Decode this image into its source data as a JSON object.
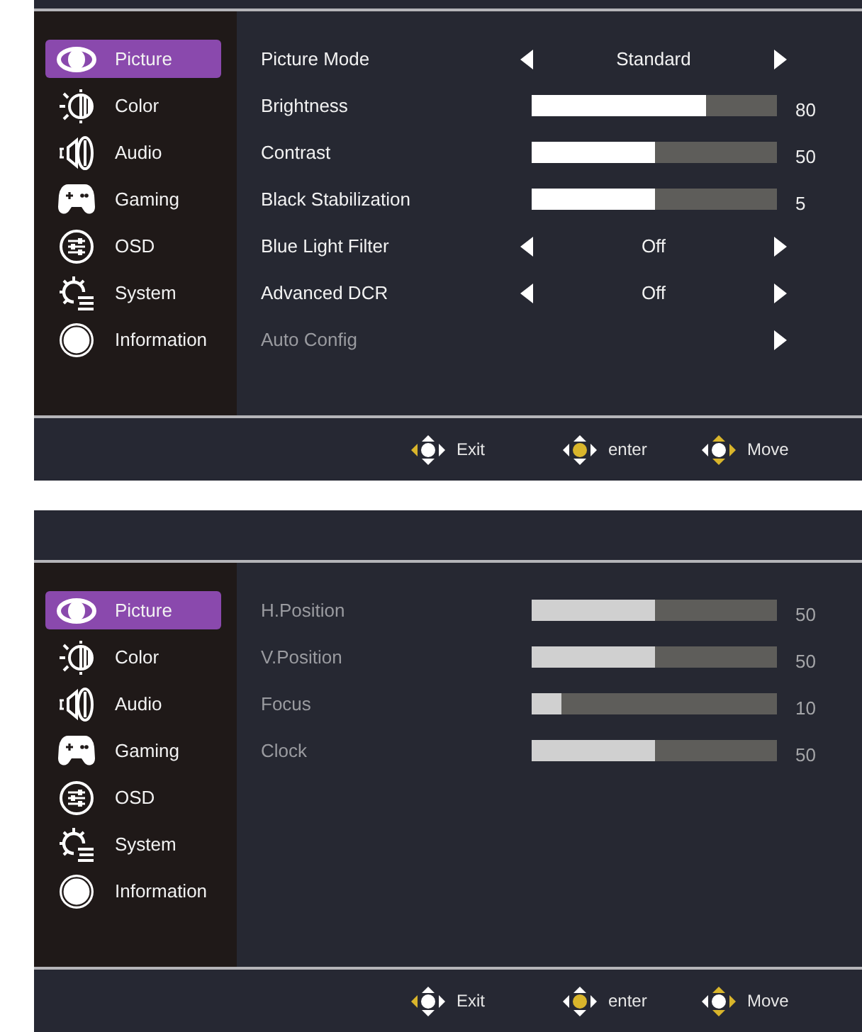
{
  "screens": [
    {
      "sidebar": {
        "items": [
          {
            "label": "Picture",
            "selected": true
          },
          {
            "label": "Color",
            "selected": false
          },
          {
            "label": "Audio",
            "selected": false
          },
          {
            "label": "Gaming",
            "selected": false
          },
          {
            "label": "OSD",
            "selected": false
          },
          {
            "label": "System",
            "selected": false
          },
          {
            "label": "Information",
            "selected": false
          }
        ]
      },
      "settings": [
        {
          "kind": "selector",
          "label": "Picture Mode",
          "value": "Standard",
          "disabled": false
        },
        {
          "kind": "slider",
          "label": "Brightness",
          "level": 0.71,
          "reading": "80",
          "disabled": false
        },
        {
          "kind": "slider",
          "label": "Contrast",
          "level": 0.5,
          "reading": "50",
          "disabled": false
        },
        {
          "kind": "slider",
          "label": "Black Stabilization",
          "level": 0.5,
          "reading": "5",
          "disabled": false
        },
        {
          "kind": "selector",
          "label": "Blue Light Filter",
          "value": "Off",
          "disabled": false
        },
        {
          "kind": "selector",
          "label": "Advanced DCR",
          "value": "Off",
          "disabled": false
        },
        {
          "kind": "action",
          "label": "Auto Config",
          "disabled": true
        }
      ],
      "footer": {
        "hints": [
          {
            "label": "Exit",
            "highlight": {
              "up": false,
              "down": false,
              "left": true,
              "right": false,
              "center": false
            }
          },
          {
            "label": "enter",
            "highlight": {
              "up": false,
              "down": false,
              "left": false,
              "right": false,
              "center": true
            }
          },
          {
            "label": "Move",
            "highlight": {
              "up": true,
              "down": true,
              "left": false,
              "right": true,
              "center": false
            }
          }
        ]
      }
    },
    {
      "sidebar": {
        "items": [
          {
            "label": "Picture",
            "selected": true
          },
          {
            "label": "Color",
            "selected": false
          },
          {
            "label": "Audio",
            "selected": false
          },
          {
            "label": "Gaming",
            "selected": false
          },
          {
            "label": "OSD",
            "selected": false
          },
          {
            "label": "System",
            "selected": false
          },
          {
            "label": "Information",
            "selected": false
          }
        ]
      },
      "settings": [
        {
          "kind": "slider",
          "label": "H.Position",
          "level": 0.5,
          "reading": "50",
          "disabled": true
        },
        {
          "kind": "slider",
          "label": "V.Position",
          "level": 0.5,
          "reading": "50",
          "disabled": true
        },
        {
          "kind": "slider",
          "label": "Focus",
          "level": 0.12,
          "reading": "10",
          "disabled": true
        },
        {
          "kind": "slider",
          "label": "Clock",
          "level": 0.5,
          "reading": "50",
          "disabled": true
        }
      ],
      "footer": {
        "hints": [
          {
            "label": "Exit",
            "highlight": {
              "up": false,
              "down": false,
              "left": true,
              "right": false,
              "center": false
            }
          },
          {
            "label": "enter",
            "highlight": {
              "up": false,
              "down": false,
              "left": false,
              "right": false,
              "center": true
            }
          },
          {
            "label": "Move",
            "highlight": {
              "up": true,
              "down": true,
              "left": false,
              "right": true,
              "center": false
            }
          }
        ]
      }
    }
  ]
}
